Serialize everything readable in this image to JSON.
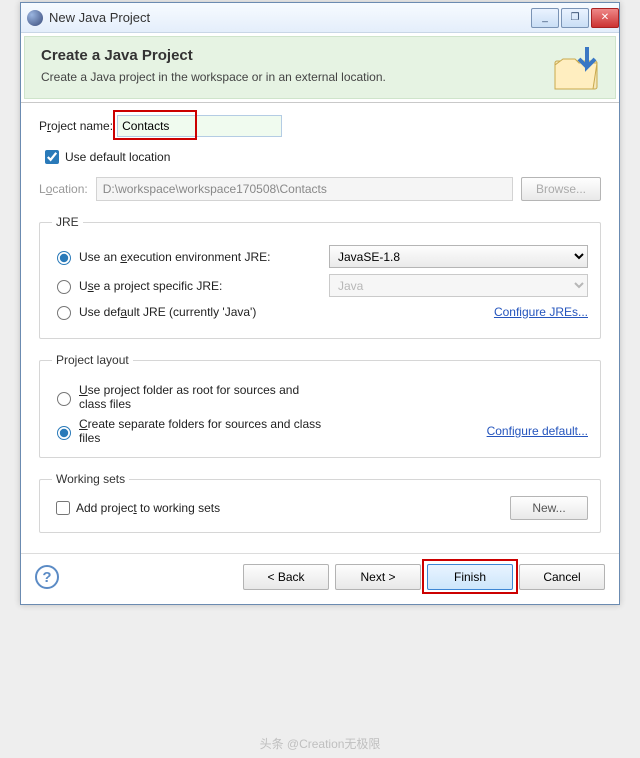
{
  "window": {
    "title": "New Java Project",
    "min": "_",
    "max": "❐",
    "close": "✕"
  },
  "header": {
    "title": "Create a Java Project",
    "subtitle": "Create a Java project in the workspace or in an external location."
  },
  "project": {
    "name_label_pre": "P",
    "name_label_u": "r",
    "name_label_post": "oject name:",
    "name_value": "Contacts"
  },
  "default_loc": {
    "label": "Use default location",
    "checked": true
  },
  "location": {
    "label_pre": "L",
    "label_u": "o",
    "label_post": "cation:",
    "value": "D:\\workspace\\workspace170508\\Contacts",
    "browse": "Browse..."
  },
  "jre": {
    "legend": "JRE",
    "opt1_pre": "Use an ",
    "opt1_u": "e",
    "opt1_post": "xecution environment JRE:",
    "opt1_val": "JavaSE-1.8",
    "opt2_pre": "U",
    "opt2_u": "s",
    "opt2_post": "e a project specific JRE:",
    "opt2_val": "Java",
    "opt3_pre": "Use def",
    "opt3_u": "a",
    "opt3_post": "ult JRE (currently 'Java')",
    "link": "Configure JREs..."
  },
  "layout": {
    "legend": "Project layout",
    "opt1_u": "U",
    "opt1_post": "se project folder as root for sources and class files",
    "opt2_u": "C",
    "opt2_post": "reate separate folders for sources and class files",
    "link": "Configure default..."
  },
  "ws": {
    "legend": "Working sets",
    "chk_pre": "Add projec",
    "chk_u": "t",
    "chk_post": " to working sets",
    "new": "New..."
  },
  "buttons": {
    "back": "< Back",
    "next": "Next >",
    "finish": "Finish",
    "cancel": "Cancel"
  },
  "watermark": "头条 @Creation无极限"
}
